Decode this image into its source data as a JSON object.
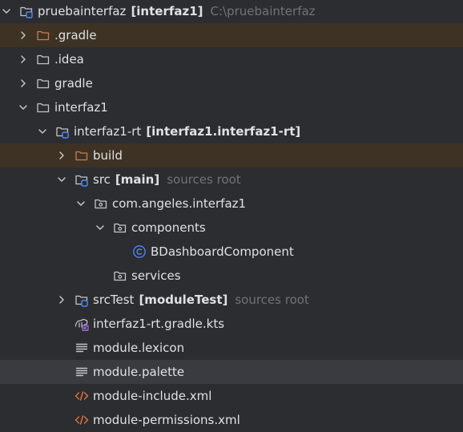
{
  "colors": {
    "background": "#2b2d30",
    "excluded_row": "#3d3223",
    "selected_row": "#393b40",
    "text": "#dfe1e5",
    "hint": "#6f737a",
    "excluded_folder": "#c77d55",
    "module_marker": "#548af7"
  },
  "tree": {
    "root": {
      "name": "pruebainterfaz",
      "module": "[interfaz1]",
      "path": "C:\\pruebainterfaz",
      "icon": "module-folder-icon"
    },
    "gradle_cache": {
      "name": ".gradle",
      "icon": "excluded-folder-icon"
    },
    "idea": {
      "name": ".idea",
      "icon": "folder-icon"
    },
    "gradle": {
      "name": "gradle",
      "icon": "folder-icon"
    },
    "interfaz1": {
      "name": "interfaz1",
      "icon": "folder-icon"
    },
    "interfaz1_rt": {
      "name": "interfaz1-rt",
      "module": "[interfaz1.interfaz1-rt]",
      "icon": "module-folder-icon"
    },
    "build": {
      "name": "build",
      "icon": "excluded-folder-icon"
    },
    "src": {
      "name": "src",
      "module": "[main]",
      "hint": "sources root",
      "icon": "source-root-icon"
    },
    "package": {
      "name": "com.angeles.interfaz1",
      "icon": "package-icon"
    },
    "components": {
      "name": "components",
      "icon": "package-icon"
    },
    "component_class": {
      "name": "BDashboardComponent",
      "icon": "class-icon"
    },
    "services": {
      "name": "services",
      "icon": "package-icon"
    },
    "src_test": {
      "name": "srcTest",
      "module": "[moduleTest]",
      "hint": "sources root",
      "icon": "source-root-icon"
    },
    "gradle_kts": {
      "name": "interfaz1-rt.gradle.kts",
      "icon": "gradle-kotlin-icon"
    },
    "lexicon": {
      "name": "module.lexicon",
      "icon": "text-file-icon"
    },
    "palette": {
      "name": "module.palette",
      "icon": "text-file-icon"
    },
    "include_xml": {
      "name": "module-include.xml",
      "icon": "xml-icon"
    },
    "permissions_xml": {
      "name": "module-permissions.xml",
      "icon": "xml-icon"
    }
  }
}
